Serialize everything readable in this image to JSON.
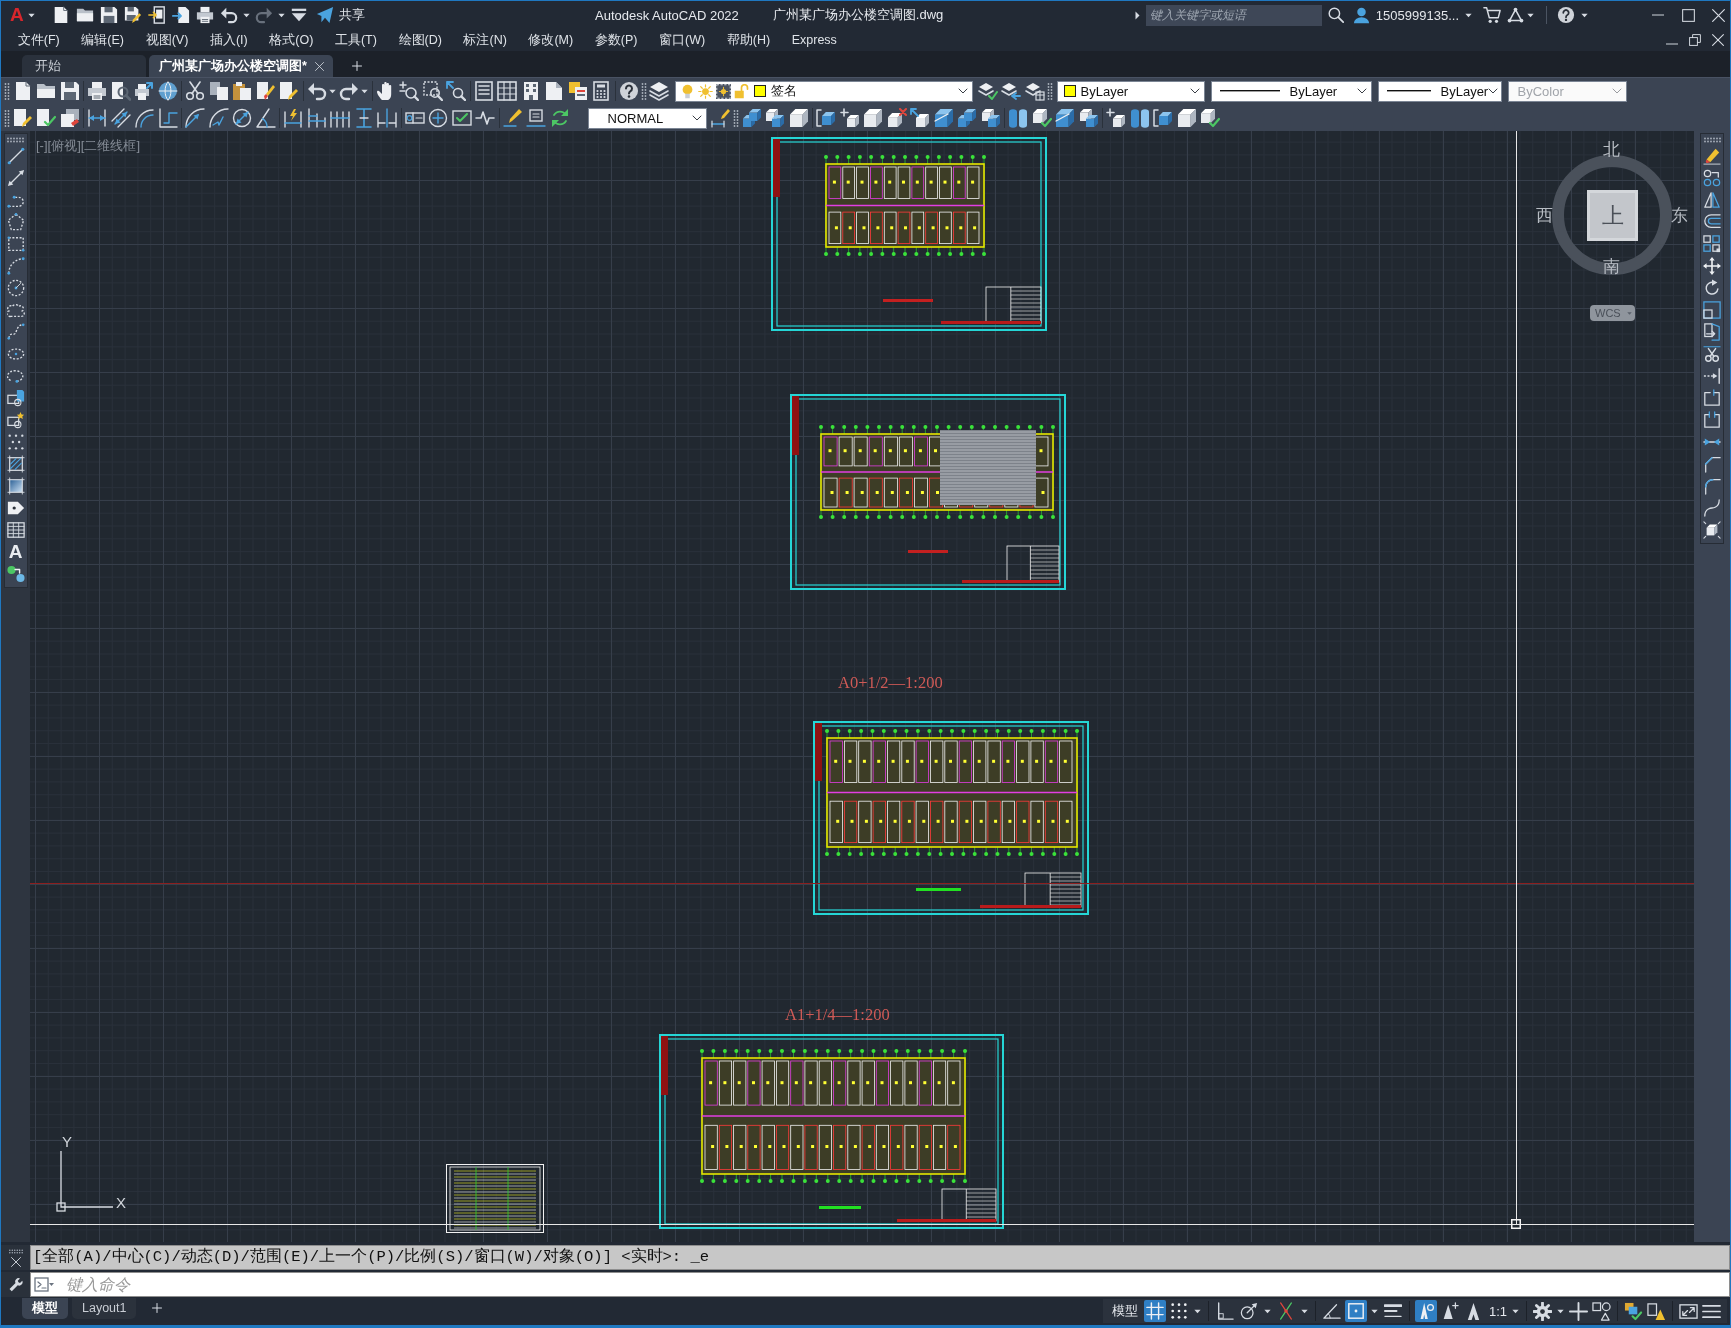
{
  "title_bar": {
    "logo": "A",
    "share_label": "共享",
    "app_name": "Autodesk AutoCAD 2022",
    "file_name": "广州某广场办公楼空调图.dwg",
    "search": {
      "placeholder": "键入关键字或短语"
    },
    "user_name": "1505999135..."
  },
  "menu_bar": [
    "文件(F)",
    "编辑(E)",
    "视图(V)",
    "插入(I)",
    "格式(O)",
    "工具(T)",
    "绘图(D)",
    "标注(N)",
    "修改(M)",
    "参数(P)",
    "窗口(W)",
    "帮助(H)",
    "Express"
  ],
  "file_tabs": [
    {
      "label": "开始",
      "selected": false
    },
    {
      "label": "广州某广场办公楼空调图*",
      "selected": true
    }
  ],
  "properties_toolbar": {
    "layer": "签名",
    "object_color": "ByLayer",
    "linetype": "ByLayer",
    "lineweight": "ByLayer",
    "plot_style": {
      "value": "ByColor",
      "disabled": true
    }
  },
  "dimension_toolbar": {
    "dim_style": "NORMAL"
  },
  "draw_toolbar": {
    "text_tool": "A"
  },
  "viewport": {
    "label": "[-][俯视][二维线框]",
    "sheet_captions": [
      "A0+1/2—1:200",
      "A1+1/4—1:200"
    ],
    "viewcube": {
      "north": "北",
      "west": "西",
      "east": "东",
      "south": "南",
      "face": "上",
      "coordinate_system": "WCS"
    },
    "ucs_icon": {
      "y_label": "Y",
      "x_label": "X"
    }
  },
  "command_line": {
    "history": "[全部(A)/中心(C)/动态(D)/范围(E)/上一个(P)/比例(S)/窗口(W)/对象(O)] <实时>: _e",
    "input": {
      "placeholder": "键入命令"
    }
  },
  "layout_tabs": [
    {
      "label": "模型",
      "selected": true
    },
    {
      "label": "Layout1",
      "selected": false
    }
  ],
  "status_bar": {
    "model_button": "模型",
    "toggles": [
      {
        "on": true
      },
      {
        "on": false
      },
      {
        "on": false
      },
      {
        "on": false
      },
      {
        "on": false
      },
      {
        "on": false
      },
      {
        "on": true
      },
      {
        "on": false
      },
      {
        "on": true
      },
      {
        "on": false
      }
    ],
    "annotation_scale": "1:1"
  }
}
